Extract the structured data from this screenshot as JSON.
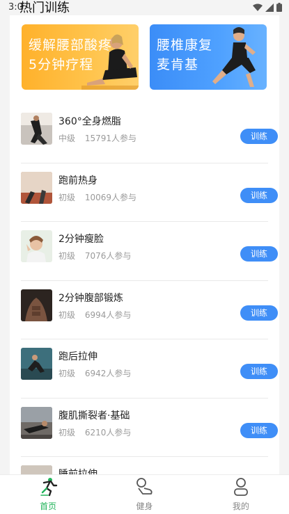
{
  "status_bar": {
    "time": "3:0"
  },
  "header": {
    "title": "热门训练"
  },
  "banners": [
    {
      "line1": "缓解腰部酸疼",
      "line2": "5分钟疗程",
      "color": "#ffb12b"
    },
    {
      "line1": "腰椎康复",
      "line2": "麦肯基",
      "color": "#3b8df7"
    }
  ],
  "list": {
    "button_label": "训练",
    "items": [
      {
        "title": "360°全身燃脂",
        "level": "中级",
        "participants": "15791人参与"
      },
      {
        "title": "跑前热身",
        "level": "初级",
        "participants": "10069人参与"
      },
      {
        "title": "2分钟瘦脸",
        "level": "初级",
        "participants": "7076人参与"
      },
      {
        "title": "2分钟腹部锻炼",
        "level": "初级",
        "participants": "6994人参与"
      },
      {
        "title": "跑后拉伸",
        "level": "初级",
        "participants": "6942人参与"
      },
      {
        "title": "腹肌撕裂者·基础",
        "level": "初级",
        "participants": "6210人参与"
      },
      {
        "title": "睡前拉伸",
        "level": "",
        "participants": ""
      }
    ]
  },
  "bottom_nav": {
    "items": [
      {
        "label": "首页",
        "icon": "home-run-icon",
        "active": true
      },
      {
        "label": "健身",
        "icon": "fitness-icon",
        "active": false
      },
      {
        "label": "我的",
        "icon": "profile-icon",
        "active": false
      }
    ]
  },
  "colors": {
    "accent": "#3f8ef7",
    "nav_active": "#21b35a"
  }
}
